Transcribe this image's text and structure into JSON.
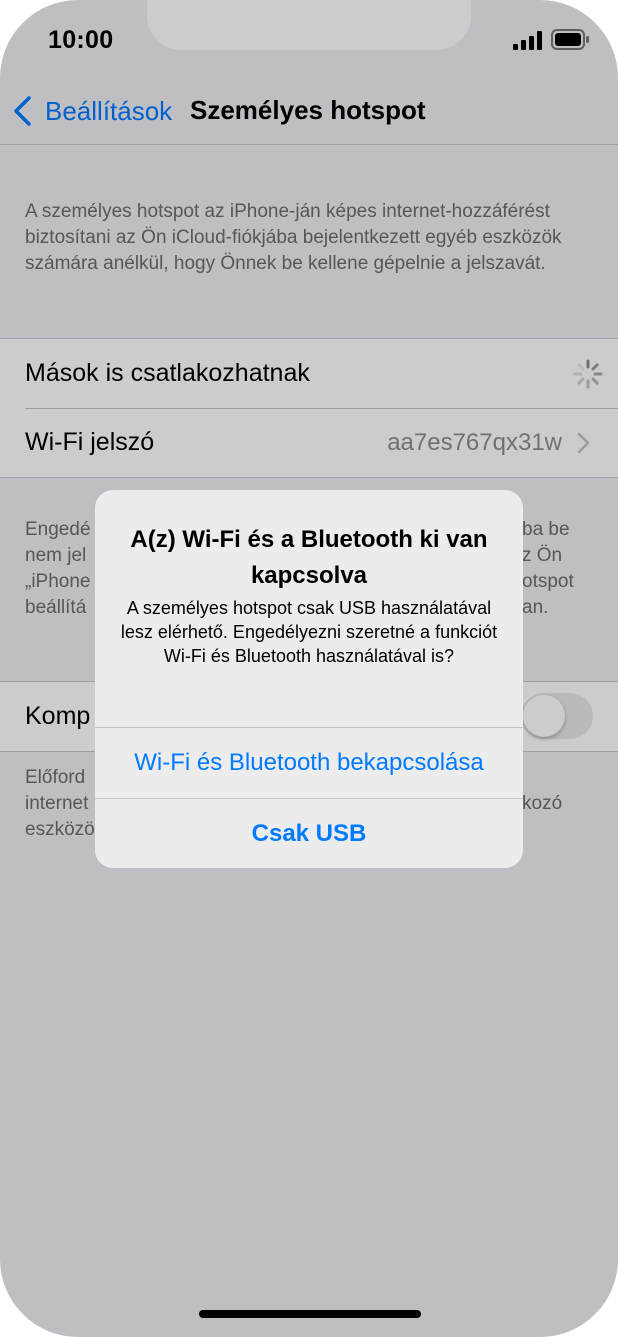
{
  "status_bar": {
    "time": "10:00"
  },
  "nav": {
    "back_label": "Beállítások",
    "title": "Személyes hotspot"
  },
  "intro_text": "A személyes hotspot az iPhone-ján képes internet-hozzáférést biztosítani az Ön iCloud-fiókjába bejelentkezett egyéb eszközök számára anélkül, hogy Önnek be kellene gépelnie a jelszavát.",
  "settings": {
    "allow_others_label": "Mások is csatlakozhatnak",
    "wifi_password_label": "Wi-Fi jelszó",
    "wifi_password_value": "aa7es767qx31w"
  },
  "hidden_texts": {
    "para2_fragments": [
      "Engedé",
      "nem jel",
      "„iPhone",
      "beállítá",
      "ba be",
      "z Ön",
      "otspot",
      "an."
    ],
    "compat_label_fragment": "Komp",
    "para3_fragments": [
      "Előford",
      "internet",
      "eszközö",
      "kozó"
    ]
  },
  "alert": {
    "title": "A(z) Wi-Fi és a Bluetooth ki van kapcsolva",
    "message": "A személyes hotspot csak USB használatával lesz elérhető. Engedélyezni szeretné a funkciót Wi-Fi és Bluetooth használatával is?",
    "button_primary": "Wi-Fi és Bluetooth bekapcsolása",
    "button_secondary": "Csak USB"
  },
  "colors": {
    "accent": "#007aff",
    "background": "#efeff4",
    "secondary_text": "#6d6d72"
  }
}
